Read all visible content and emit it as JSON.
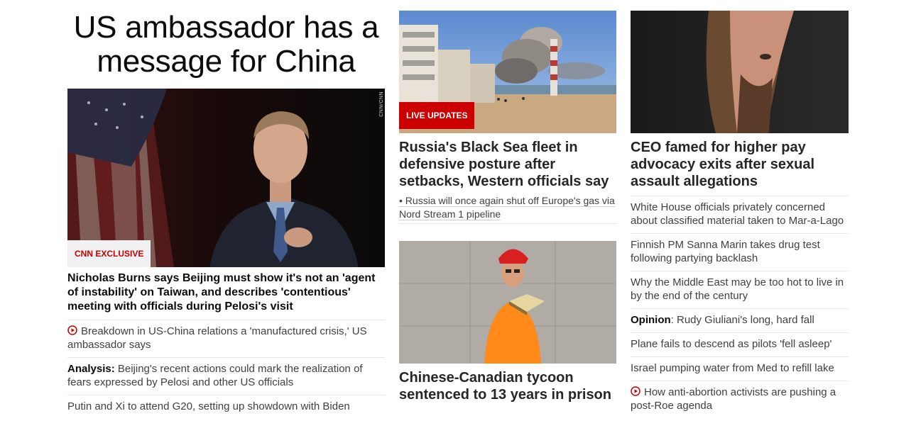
{
  "main": {
    "headline": "US ambassador has a message for China",
    "watermark": "CNN/CNN",
    "badge": "CNN EXCLUSIVE",
    "lead_title": "Nicholas Burns says Beijing must show it's not an 'agent of instability' on Taiwan, and describes 'contentious' meeting with officials during Pelosi's visit",
    "items": [
      {
        "label": "",
        "text": "Breakdown in US-China relations a 'manufactured crisis,' US ambassador says",
        "icon": "play-icon"
      },
      {
        "label": "Analysis:",
        "text": " Beijing's recent actions could mark the realization of fears expressed by Pelosi and other US officials"
      },
      {
        "label": "",
        "text": "Putin and Xi to attend G20, setting up showdown with Biden"
      }
    ]
  },
  "middle": {
    "story1": {
      "badge": "LIVE UPDATES",
      "title": "Russia's Black Sea fleet in defensive posture after setbacks, Western officials say",
      "bullet": "• Russia will once again shut off Europe's gas via Nord Stream 1 pipeline"
    },
    "story2": {
      "title": "Chinese-Canadian tycoon sentenced to 13 years in prison"
    }
  },
  "right": {
    "story": {
      "title": "CEO famed for higher pay advocacy exits after sexual assault allegations"
    },
    "items": [
      {
        "label": "",
        "text": "White House officials privately concerned about classified material taken to Mar-a-Lago"
      },
      {
        "label": "",
        "text": "Finnish PM Sanna Marin takes drug test following partying backlash"
      },
      {
        "label": "",
        "text": "Why the Middle East may be too hot to live in by the end of the century"
      },
      {
        "label": "Opinion",
        "text": ": Rudy Giuliani's long, hard fall"
      },
      {
        "label": "",
        "text": "Plane fails to descend as pilots 'fell asleep'"
      },
      {
        "label": "",
        "text": "Israel pumping water from Med to refill lake"
      },
      {
        "label": "",
        "text": "How anti-abortion activists are pushing a post-Roe agenda",
        "icon": "play-icon"
      }
    ]
  },
  "colors": {
    "accent": "#cc0000",
    "text": "#0c0c0c",
    "secondary": "#404040",
    "divider": "#e6e6e6"
  }
}
